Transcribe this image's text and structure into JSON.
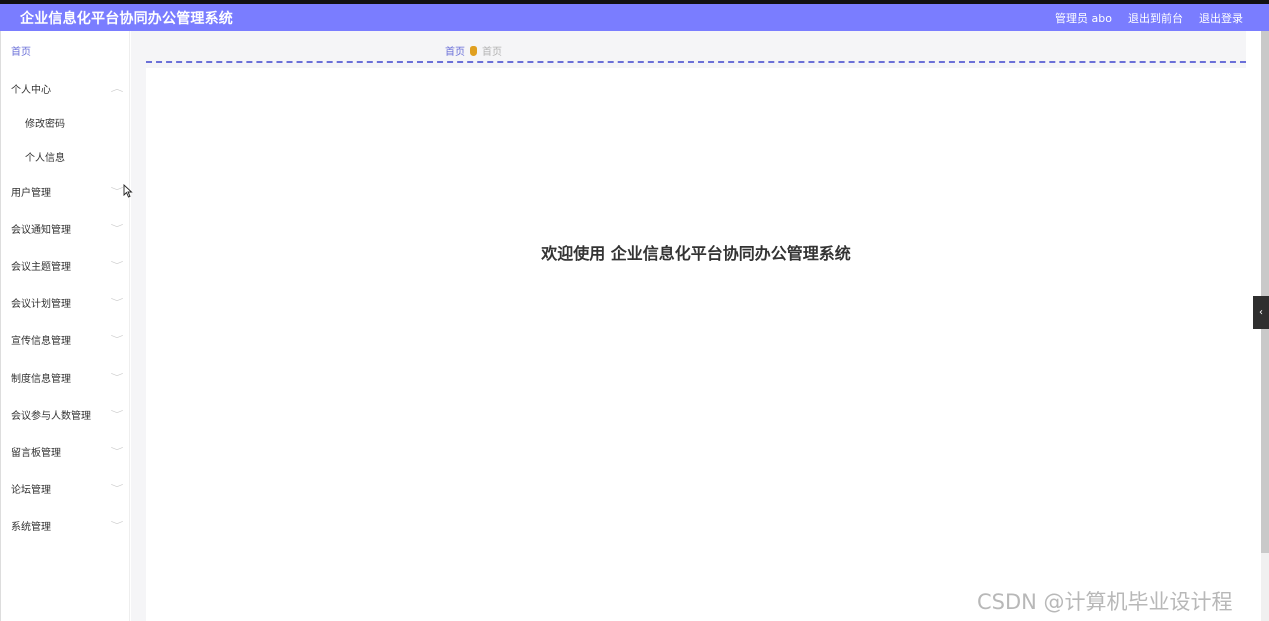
{
  "header": {
    "title": "企业信息化平台协同办公管理系统",
    "user_label": "管理员 abo",
    "to_front": "退出到前台",
    "logout": "退出登录",
    "bg_color": "#7a7dff"
  },
  "sidebar": {
    "home": "首页",
    "menus": [
      {
        "label": "个人中心",
        "expanded": true,
        "children": [
          "修改密码",
          "个人信息"
        ]
      },
      {
        "label": "用户管理"
      },
      {
        "label": "会议通知管理"
      },
      {
        "label": "会议主题管理"
      },
      {
        "label": "会议计划管理"
      },
      {
        "label": "宣传信息管理"
      },
      {
        "label": "制度信息管理"
      },
      {
        "label": "会议参与人数管理"
      },
      {
        "label": "留言板管理"
      },
      {
        "label": "论坛管理"
      },
      {
        "label": "系统管理"
      }
    ]
  },
  "breadcrumb": {
    "first": "首页",
    "second": "首页"
  },
  "main": {
    "welcome": "欢迎使用 企业信息化平台协同办公管理系统"
  },
  "watermark": "CSDN @计算机毕业设计程"
}
